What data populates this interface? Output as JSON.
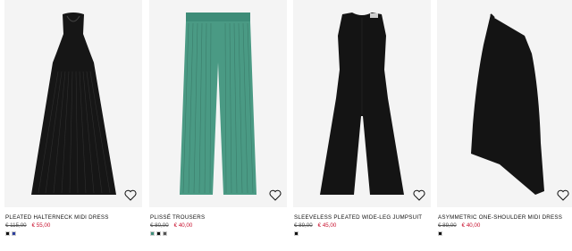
{
  "products": [
    {
      "name": "PLEATED HALTERNECK MIDI DRESS",
      "old_price": "€ 115,00",
      "price": "€ 55,00",
      "image": "pleated-halterneck-dress-image",
      "swatches": [
        "#111111",
        "#2c3e9e"
      ]
    },
    {
      "name": "PLISSÉ TROUSERS",
      "old_price": "€ 80,00",
      "price": "€ 40,00",
      "image": "plisse-trousers-image",
      "swatches": [
        "#3f8f7b",
        "#111111",
        "#555555"
      ]
    },
    {
      "name": "SLEEVELESS PLEATED WIDE-LEG JUMPSUIT",
      "old_price": "€ 89,00",
      "price": "€ 45,00",
      "image": "sleeveless-jumpsuit-image",
      "swatches": [
        "#111111"
      ]
    },
    {
      "name": "ASYMMETRIC ONE-SHOULDER MIDI DRESS",
      "old_price": "€ 89,00",
      "price": "€ 40,00",
      "image": "asymmetric-dress-image",
      "swatches": [
        "#111111"
      ]
    }
  ],
  "icons": {
    "wishlist": "heart-outline-icon"
  },
  "colors": {
    "sale": "#c8102e",
    "image_bg": "#f4f4f4"
  }
}
